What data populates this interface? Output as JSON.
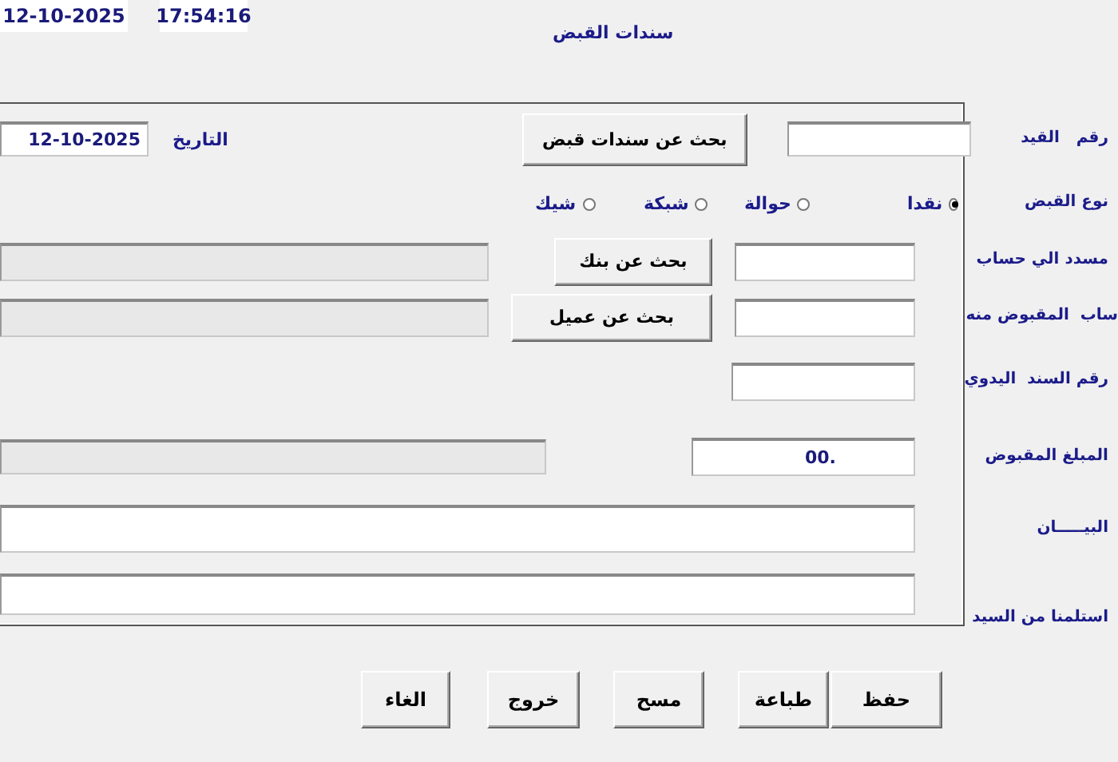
{
  "header": {
    "date": "12-10-2025",
    "time": "17:54:16",
    "title": "سندات القبض"
  },
  "form": {
    "entry_number": {
      "label": "رقم   القيد"
    },
    "search_vouchers_button": "بحث عن سندات قبض",
    "date": {
      "label": "التاريخ",
      "value": "12-10-2025"
    },
    "receipt_type": {
      "label": "نوع القبض",
      "options": [
        {
          "label": "نقدا",
          "selected": true
        },
        {
          "label": "حوالة",
          "selected": false
        },
        {
          "label": "شبكة",
          "selected": false
        },
        {
          "label": "شيك",
          "selected": false
        }
      ]
    },
    "paid_to_account": {
      "label": "مسدد الي حساب",
      "button": "بحث عن بنك"
    },
    "received_from_account": {
      "label": "ساب  المقبوض منه",
      "button": "بحث عن عميل"
    },
    "manual_voucher_number": {
      "label": "رقم السند  اليدوي"
    },
    "amount": {
      "label": "المبلغ المقبوض",
      "value": "00."
    },
    "description": {
      "label": "البيـــــان"
    },
    "received_from": {
      "label": "استلمنا من السيد"
    }
  },
  "buttons": [
    "حفظ",
    "طباعة",
    "مسح",
    "خروج",
    "الغاء"
  ]
}
